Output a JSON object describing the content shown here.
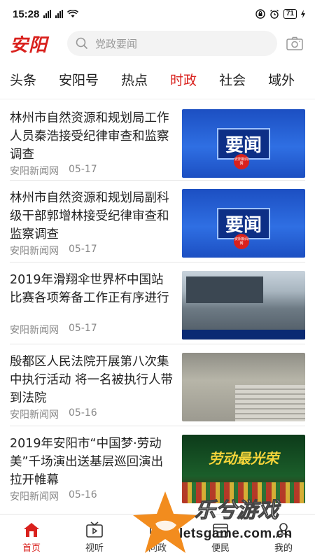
{
  "status_bar": {
    "time": "15:28",
    "battery": "71"
  },
  "header": {
    "logo": "安阳",
    "search_placeholder": "党政要闻"
  },
  "tabs": [
    {
      "label": "头条",
      "active": false
    },
    {
      "label": "安阳号",
      "active": false
    },
    {
      "label": "热点",
      "active": false
    },
    {
      "label": "时政",
      "active": true
    },
    {
      "label": "社会",
      "active": false
    },
    {
      "label": "域外",
      "active": false
    }
  ],
  "news": [
    {
      "title": "林州市自然资源和规划局工作人员秦浩接受纪律审查和监察调查",
      "source": "安阳新闻网",
      "date": "05-17",
      "thumb_text": "要闻",
      "thumb_badge": "安阳新闻网"
    },
    {
      "title": "林州市自然资源和规划局副科级干部郭增林接受纪律审查和监察调查",
      "source": "安阳新闻网",
      "date": "05-17",
      "thumb_text": "要闻",
      "thumb_badge": "安阳新闻网"
    },
    {
      "title": "2019年滑翔伞世界杯中国站比赛各项筹备工作正有序进行",
      "source": "安阳新闻网",
      "date": "05-17"
    },
    {
      "title": "殷都区人民法院开展第八次集中执行活动 将一名被执行人带到法院",
      "source": "安阳新闻网",
      "date": "05-16"
    },
    {
      "title": "2019年安阳市“中国梦·劳动美”千场演出送基层巡回演出拉开帷幕",
      "source": "安阳新闻网",
      "date": "05-16",
      "thumb_text": "劳动最光荣"
    }
  ],
  "bottom_nav": [
    {
      "label": "首页",
      "icon": "home-icon",
      "active": true
    },
    {
      "label": "视听",
      "icon": "tv-icon",
      "active": false
    },
    {
      "label": "问政",
      "icon": "ask-icon",
      "active": false
    },
    {
      "label": "便民",
      "icon": "service-icon",
      "active": false
    },
    {
      "label": "我的",
      "icon": "user-icon",
      "active": false
    }
  ],
  "watermark": {
    "text": "乐兮游戏",
    "url": "letsgame.com.cn"
  },
  "colors": {
    "accent": "#d9211d",
    "meta": "#888888",
    "divider": "#e6e6e6"
  }
}
